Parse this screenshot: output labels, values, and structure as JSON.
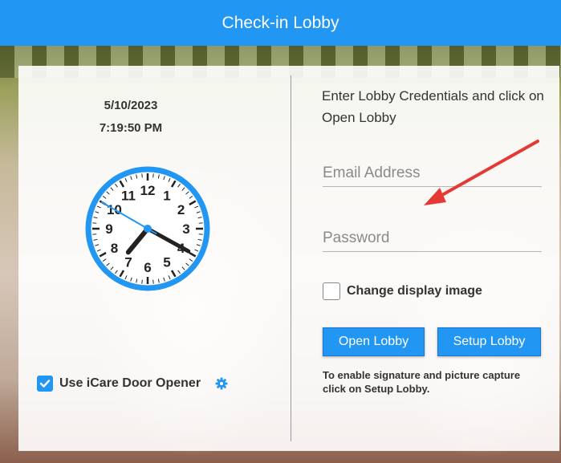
{
  "header": {
    "title": "Check-in Lobby"
  },
  "clock_panel": {
    "date": "5/10/2023",
    "time": "7:19:50 PM",
    "clock": {
      "hours": 7,
      "minutes": 19,
      "seconds": 50,
      "numerals": [
        "12",
        "1",
        "2",
        "3",
        "4",
        "5",
        "6",
        "7",
        "8",
        "9",
        "10",
        "11"
      ]
    },
    "door_opener": {
      "label": "Use iCare Door Opener",
      "checked": true
    }
  },
  "login_panel": {
    "instructions": "Enter Lobby Credentials and click on Open Lobby",
    "email": {
      "placeholder": "Email Address",
      "value": ""
    },
    "password": {
      "placeholder": "Password",
      "value": ""
    },
    "change_image": {
      "label": "Change display image",
      "checked": false
    },
    "open_label": "Open Lobby",
    "setup_label": "Setup Lobby",
    "hint": "To enable signature and picture capture click on Setup Lobby."
  },
  "colors": {
    "accent": "#2196f3",
    "annotation_arrow": "#e53935"
  },
  "icons": [
    "check-icon",
    "gear-icon"
  ]
}
